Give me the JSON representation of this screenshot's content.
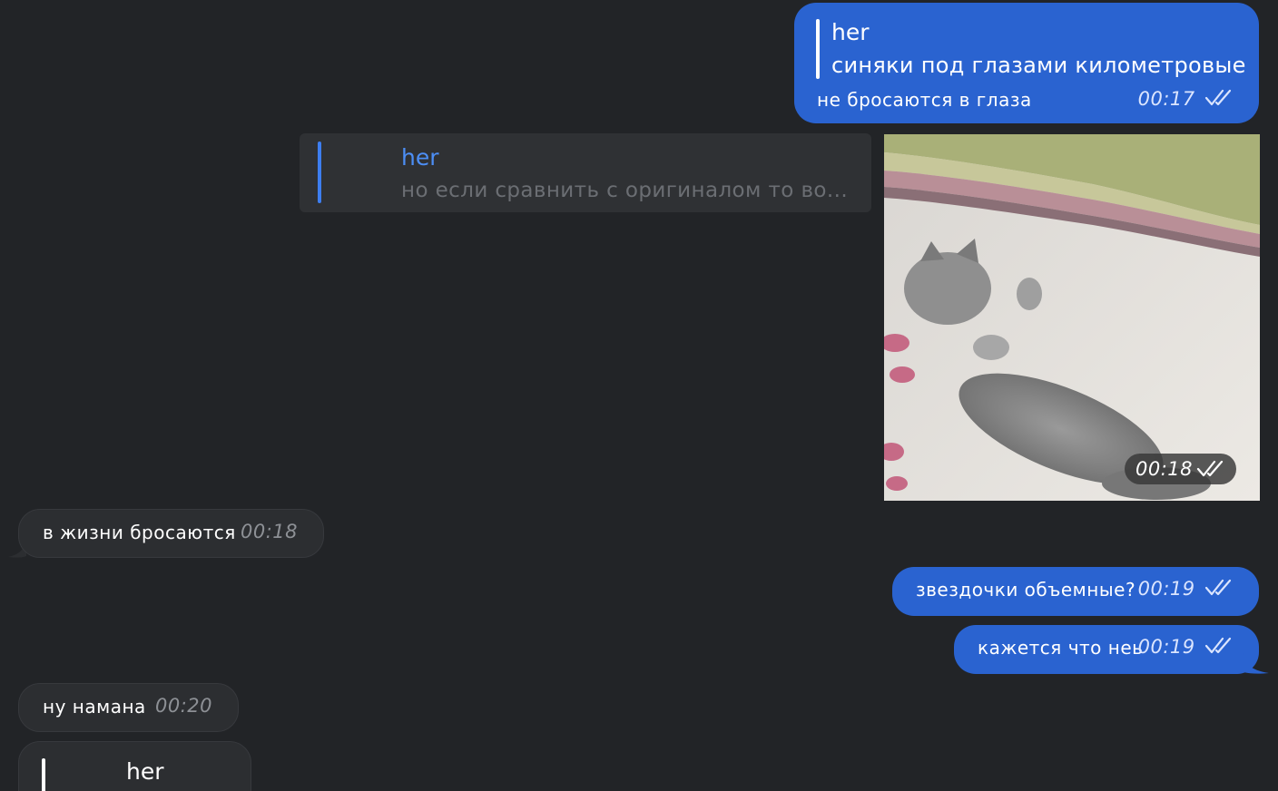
{
  "messages": {
    "m1": {
      "quote_author": "her",
      "quote_text": "синяки под глазами километровые",
      "text": "не бросаются в глаза",
      "time": "00:17"
    },
    "m2": {
      "quote_author": "her",
      "quote_text": "но если сравнить с оригиналом то во...",
      "time": "00:18"
    },
    "m3": {
      "text": "в жизни бросаются",
      "time": "00:18"
    },
    "m4": {
      "text": "звездочки объемные?",
      "time": "00:19"
    },
    "m5": {
      "text": "кажется что неь",
      "time": "00:19"
    },
    "m6": {
      "text": "ну намана",
      "time": "00:20"
    },
    "m7": {
      "quote_author": "her"
    }
  },
  "colors": {
    "background": "#222427",
    "outgoing": "#2a63d0",
    "incoming": "#2c2e31",
    "accent": "#4c8ef5"
  },
  "icons": {
    "read_receipt": "double-check-icon",
    "image": "sleeping-kitten-image"
  }
}
